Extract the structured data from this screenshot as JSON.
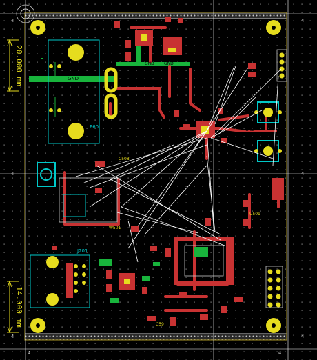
{
  "dimensions": {
    "top": "20.000 mm",
    "bottom": "14.000 mm"
  },
  "nets": {
    "gnd": "GND"
  },
  "references": {
    "p60": "P60",
    "j201": "J201",
    "c508": "C508",
    "u501": "U501",
    "w501": "W501",
    "c59": "C59"
  },
  "corner_marks": [
    "4",
    "4",
    "4",
    "4",
    "4",
    "4",
    "4",
    "4"
  ],
  "colors": {
    "background": "#000000",
    "board_outline": "#c8c8c8",
    "front_copper": "#c83232",
    "ground_pour": "#18b43c",
    "pad_yellow": "#e6dc1e",
    "ratsnest": "#ffffff",
    "silkscreen": "#00c8c8",
    "grid_dot": "#8a8a8a",
    "dimension": "#e6dc1e"
  }
}
